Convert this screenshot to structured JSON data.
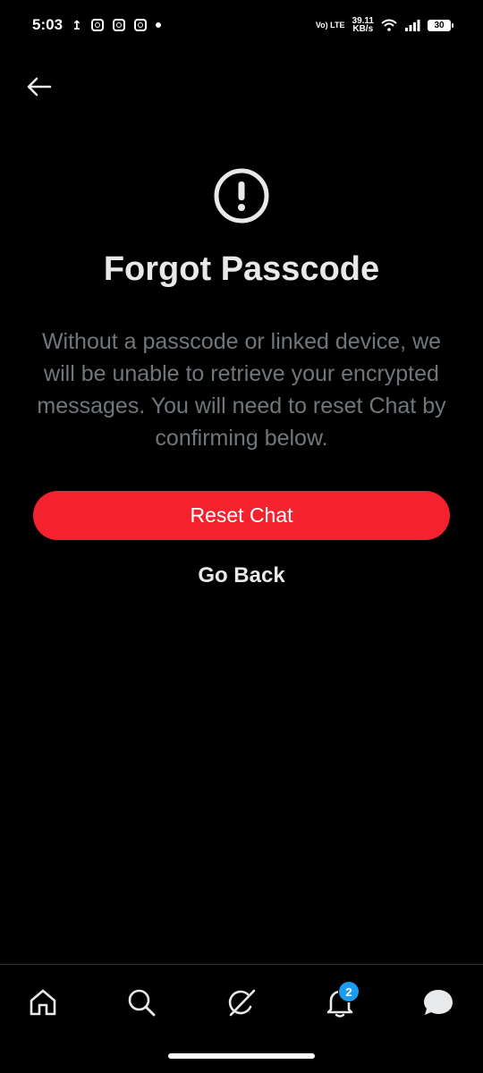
{
  "status_bar": {
    "time": "5:03",
    "upload_glyph": "↥",
    "network_label": "Vo) LTE",
    "speed_value": "39.11",
    "speed_unit": "KB/s",
    "battery": "30"
  },
  "icons": {
    "back": "arrow-left-icon",
    "alert": "exclamation-circle-icon"
  },
  "content": {
    "title": "Forgot Passcode",
    "description": "Without a passcode or linked device, we will be unable to retrieve your encrypted messages. You will need to reset Chat by confirming below.",
    "reset_button": "Reset Chat",
    "go_back_button": "Go Back"
  },
  "colors": {
    "background": "#000000",
    "primary_text": "#e7e9ea",
    "secondary_text": "#71767b",
    "danger": "#f4212e",
    "badge": "#1d9bf0"
  },
  "bottom_nav": {
    "items": [
      {
        "name": "home",
        "icon": "home-icon"
      },
      {
        "name": "search",
        "icon": "search-icon"
      },
      {
        "name": "grok",
        "icon": "grok-icon"
      },
      {
        "name": "notifications",
        "icon": "bell-icon",
        "badge": "2"
      },
      {
        "name": "messages",
        "icon": "chat-bubble-icon"
      }
    ]
  }
}
